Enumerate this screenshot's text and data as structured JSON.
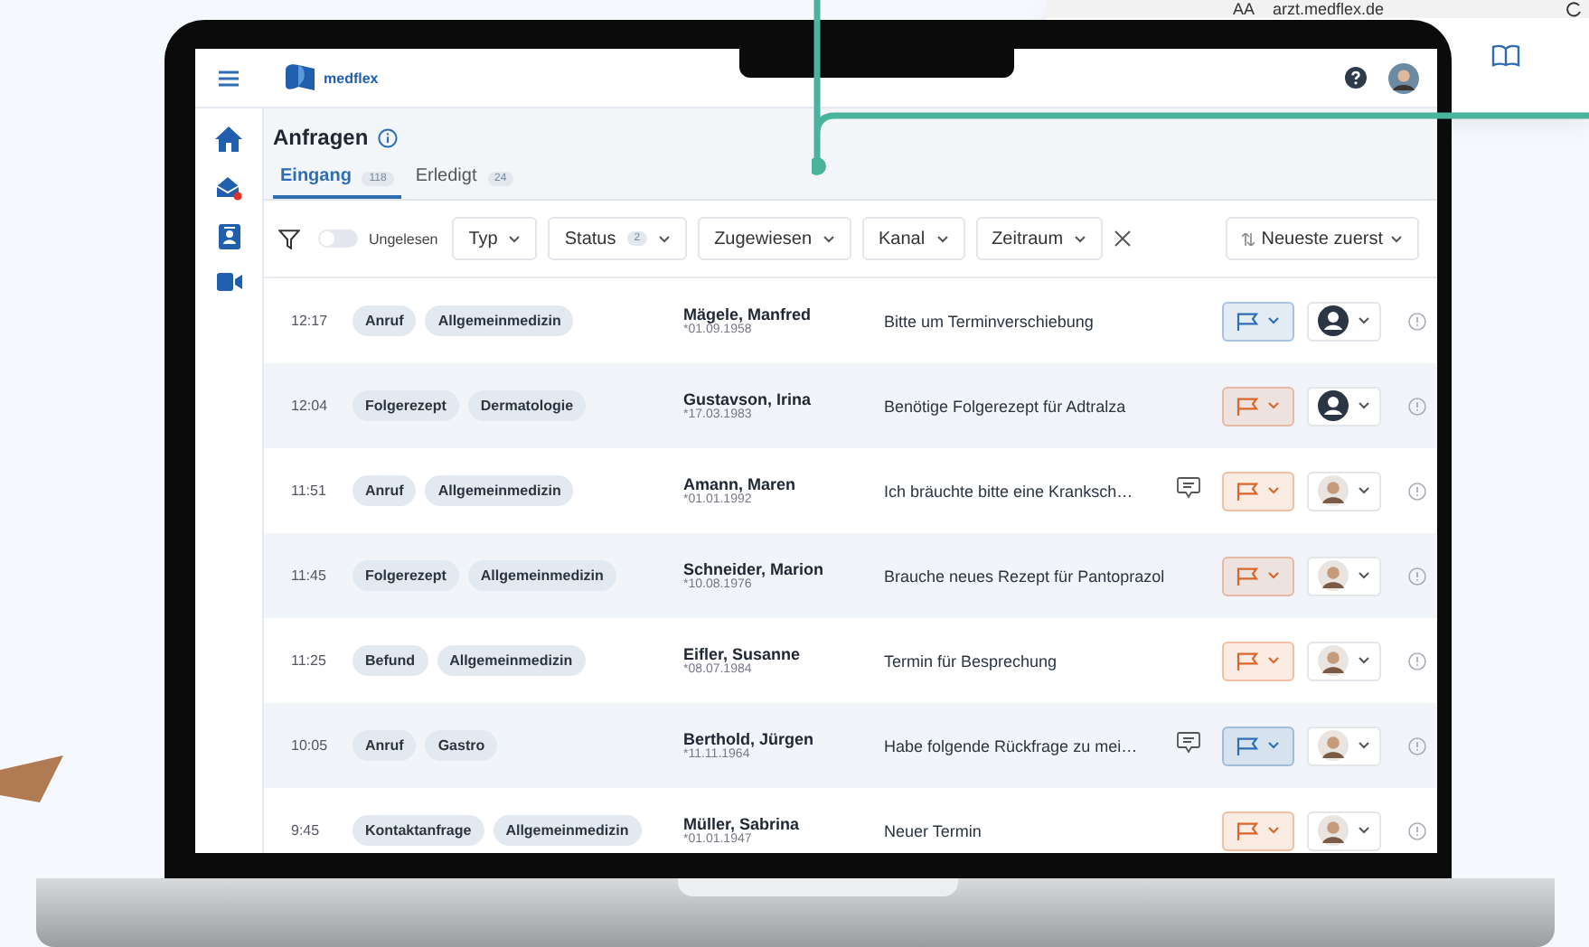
{
  "browser": {
    "reader": "AA",
    "url": "arzt.medflex.de"
  },
  "logo": "medflex",
  "sidebar": {
    "items": [
      {
        "kind": "home",
        "badge": false
      },
      {
        "kind": "mail",
        "badge": true
      },
      {
        "kind": "contact",
        "badge": false
      },
      {
        "kind": "video",
        "badge": false
      }
    ]
  },
  "title": "Anfragen",
  "tabs": [
    {
      "label": "Eingang",
      "count": "118",
      "selected": true
    },
    {
      "label": "Erledigt",
      "count": "24",
      "selected": false
    }
  ],
  "filters": {
    "unread": {
      "label": "Ungelesen",
      "on": false
    },
    "dropdowns": [
      {
        "label": "Typ"
      },
      {
        "label": "Status",
        "count": "2"
      },
      {
        "label": "Zugewiesen"
      },
      {
        "label": "Kanal"
      },
      {
        "label": "Zeitraum"
      }
    ],
    "sort": "Neueste zuerst"
  },
  "rows": [
    {
      "time": "12:17",
      "tags": [
        "Anruf",
        "Allgemeinmedizin"
      ],
      "name": "Mägele, Manfred",
      "birth": "*01.09.1958",
      "subject": "Bitte um Terminverschiebung",
      "comment": false,
      "flag": {
        "color": "#2f6db3"
      },
      "assignee": {
        "kind": "placeholder"
      }
    },
    {
      "time": "12:04",
      "tags": [
        "Folgerezept",
        "Dermatologie"
      ],
      "name": "Gustavson, Irina",
      "birth": "*17.03.1983",
      "subject": "Benötige Folgerezept für Adtralza",
      "comment": false,
      "flag": {
        "color": "#d9662b"
      },
      "assignee": {
        "kind": "placeholder"
      }
    },
    {
      "time": "11:51",
      "tags": [
        "Anruf",
        "Allgemeinmedizin"
      ],
      "name": "Amann, Maren",
      "birth": "*01.01.1992",
      "subject": "Ich bräuchte bitte eine Kranksch…",
      "comment": true,
      "flag": {
        "color": "#d9662b"
      },
      "assignee": {
        "kind": "photo"
      }
    },
    {
      "time": "11:45",
      "tags": [
        "Folgerezept",
        "Allgemeinmedizin"
      ],
      "name": "Schneider, Marion",
      "birth": "*10.08.1976",
      "subject": "Brauche neues Rezept für Pantoprazol",
      "comment": false,
      "flag": {
        "color": "#d9662b"
      },
      "assignee": {
        "kind": "photo"
      }
    },
    {
      "time": "11:25",
      "tags": [
        "Befund",
        "Allgemeinmedizin"
      ],
      "name": "Eifler, Susanne",
      "birth": "*08.07.1984",
      "subject": "Termin für Besprechung",
      "comment": false,
      "flag": {
        "color": "#d9662b"
      },
      "assignee": {
        "kind": "photo"
      }
    },
    {
      "time": "10:05",
      "tags": [
        "Anruf",
        "Gastro"
      ],
      "name": "Berthold, Jürgen",
      "birth": "*11.11.1964",
      "subject": "Habe folgende Rückfrage zu mei…",
      "comment": true,
      "flag": {
        "color": "#2f6db3"
      },
      "assignee": {
        "kind": "photo"
      }
    },
    {
      "time": "9:45",
      "tags": [
        "Kontaktanfrage",
        "Allgemeinmedizin"
      ],
      "name": "Müller, Sabrina",
      "birth": "*01.01.1947",
      "subject": "Neuer Termin",
      "comment": false,
      "flag": {
        "color": "#d9662b"
      },
      "assignee": {
        "kind": "photo"
      }
    }
  ]
}
